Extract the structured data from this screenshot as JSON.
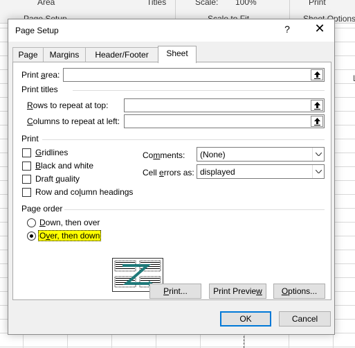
{
  "background": {
    "ribbon_labels": [
      "Page Setup",
      "Area",
      "Titles",
      "Scale:",
      "100%",
      "Scale to Fit",
      "Print",
      "Sheet Options"
    ],
    "right_column_label": "L"
  },
  "dialog": {
    "title": "Page Setup",
    "help": "?",
    "close": "✕",
    "tabs": [
      "Page",
      "Margins",
      "Header/Footer",
      "Sheet"
    ],
    "active_tab": "Sheet",
    "print_area": {
      "label_pre": "Print ",
      "label_u": "a",
      "label_post": "rea:",
      "value": ""
    },
    "print_titles": {
      "heading": "Print titles",
      "rows": {
        "label_pre": "",
        "label_u": "R",
        "label_post": "ows to repeat at top:",
        "value": ""
      },
      "cols": {
        "label_pre": "",
        "label_u": "C",
        "label_post": "olumns to repeat at left:",
        "value": ""
      }
    },
    "print": {
      "heading": "Print",
      "gridlines": {
        "label_pre": "",
        "label_u": "G",
        "label_post": "ridlines",
        "checked": false
      },
      "black_white": {
        "label_pre": "",
        "label_u": "B",
        "label_post": "lack and white",
        "checked": false
      },
      "draft": {
        "label_pre": "Draft ",
        "label_u": "q",
        "label_post": "uality",
        "checked": false
      },
      "headings": {
        "label_pre": "Row and co",
        "label_u": "l",
        "label_post": "umn headings",
        "checked": false
      },
      "comments": {
        "label_pre": "Co",
        "label_u": "m",
        "label_post": "ments:",
        "value": "(None)"
      },
      "errors": {
        "label_pre": "Cell ",
        "label_u": "e",
        "label_post": "rrors as:",
        "value": "displayed"
      }
    },
    "page_order": {
      "heading": "Page order",
      "down_over": {
        "label_pre": "",
        "label_u": "D",
        "label_post": "own, then over",
        "selected": false
      },
      "over_down": {
        "label_pre": "O",
        "label_u": "v",
        "label_post": "er, then down",
        "selected": true
      }
    },
    "buttons": {
      "print": {
        "pre": "",
        "u": "P",
        "post": "rint..."
      },
      "preview": {
        "pre": "Print Previe",
        "u": "w",
        "post": ""
      },
      "options": {
        "pre": "",
        "u": "O",
        "post": "ptions..."
      },
      "ok": "OK",
      "cancel": "Cancel"
    },
    "colors": {
      "highlight": "#ffff00",
      "accent": "#0078d7",
      "preview_z": "#1f7a7a"
    }
  }
}
